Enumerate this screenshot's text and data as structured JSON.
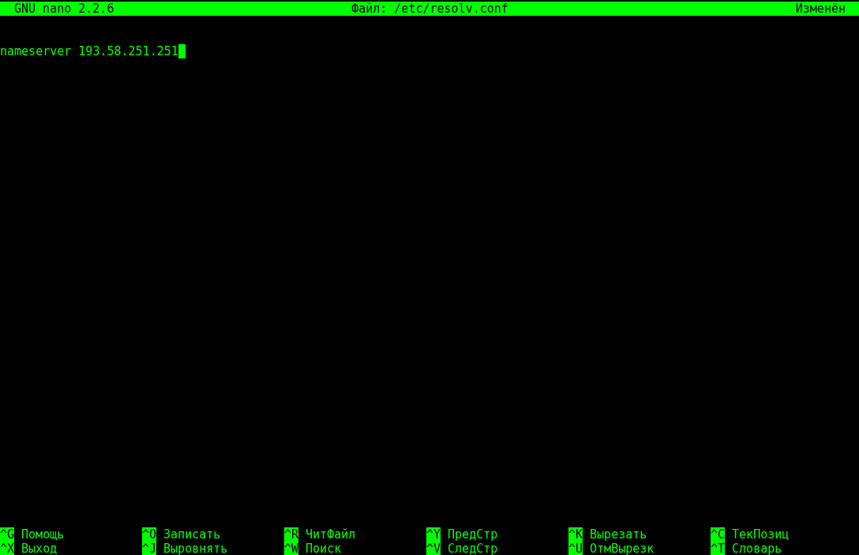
{
  "title_bar": {
    "version": "GNU nano 2.2.6",
    "file": "Файл: /etc/resolv.conf",
    "status": "Изменён"
  },
  "editor": {
    "lines": [
      {
        "text": "nameserver 193.58.251.251",
        "cursor": true
      }
    ]
  },
  "shortcuts": [
    [
      {
        "key": "^G",
        "label": "Помощь"
      },
      {
        "key": "^O",
        "label": "Записать"
      },
      {
        "key": "^R",
        "label": "ЧитФайл"
      },
      {
        "key": "^Y",
        "label": "ПредСтр"
      },
      {
        "key": "^K",
        "label": "Вырезать"
      },
      {
        "key": "^C",
        "label": "ТекПозиц"
      }
    ],
    [
      {
        "key": "^X",
        "label": "Выход"
      },
      {
        "key": "^J",
        "label": "Выровнять"
      },
      {
        "key": "^W",
        "label": "Поиск"
      },
      {
        "key": "^V",
        "label": "СледСтр"
      },
      {
        "key": "^U",
        "label": "ОтмВырезк"
      },
      {
        "key": "^T",
        "label": "Словарь"
      }
    ]
  ]
}
